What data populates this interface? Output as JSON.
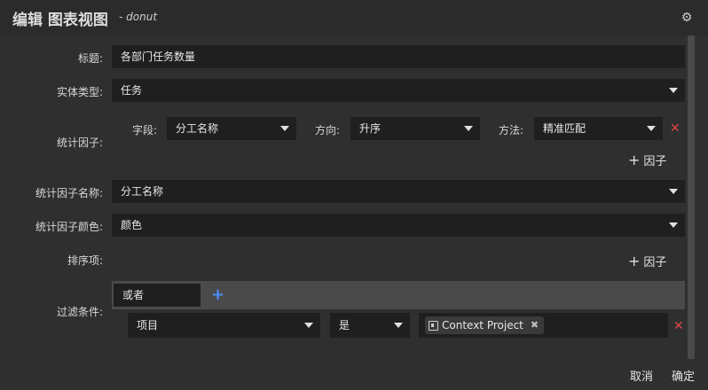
{
  "header": {
    "title": "编辑 图表视图",
    "subtitle": "- donut",
    "settings_icon": "gear-icon"
  },
  "form": {
    "title": {
      "label": "标题:",
      "value": "各部门任务数量"
    },
    "entity_type": {
      "label": "实体类型:",
      "value": "任务"
    },
    "factors": {
      "label": "统计因子:",
      "field_label": "字段:",
      "field_value": "分工名称",
      "direction_label": "方向:",
      "direction_value": "升序",
      "method_label": "方法:",
      "method_value": "精准匹配",
      "add_label": "因子"
    },
    "factor_name": {
      "label": "统计因子名称:",
      "value": "分工名称"
    },
    "factor_color": {
      "label": "统计因子颜色:",
      "value": "颜色"
    },
    "sort": {
      "label": "排序项:",
      "add_label": "因子"
    },
    "filters": {
      "label": "过滤条件:",
      "logic_value": "或者",
      "condition": {
        "field": "项目",
        "operator": "是",
        "chip": "Context Project"
      }
    }
  },
  "footer": {
    "cancel": "取消",
    "confirm": "确定"
  }
}
